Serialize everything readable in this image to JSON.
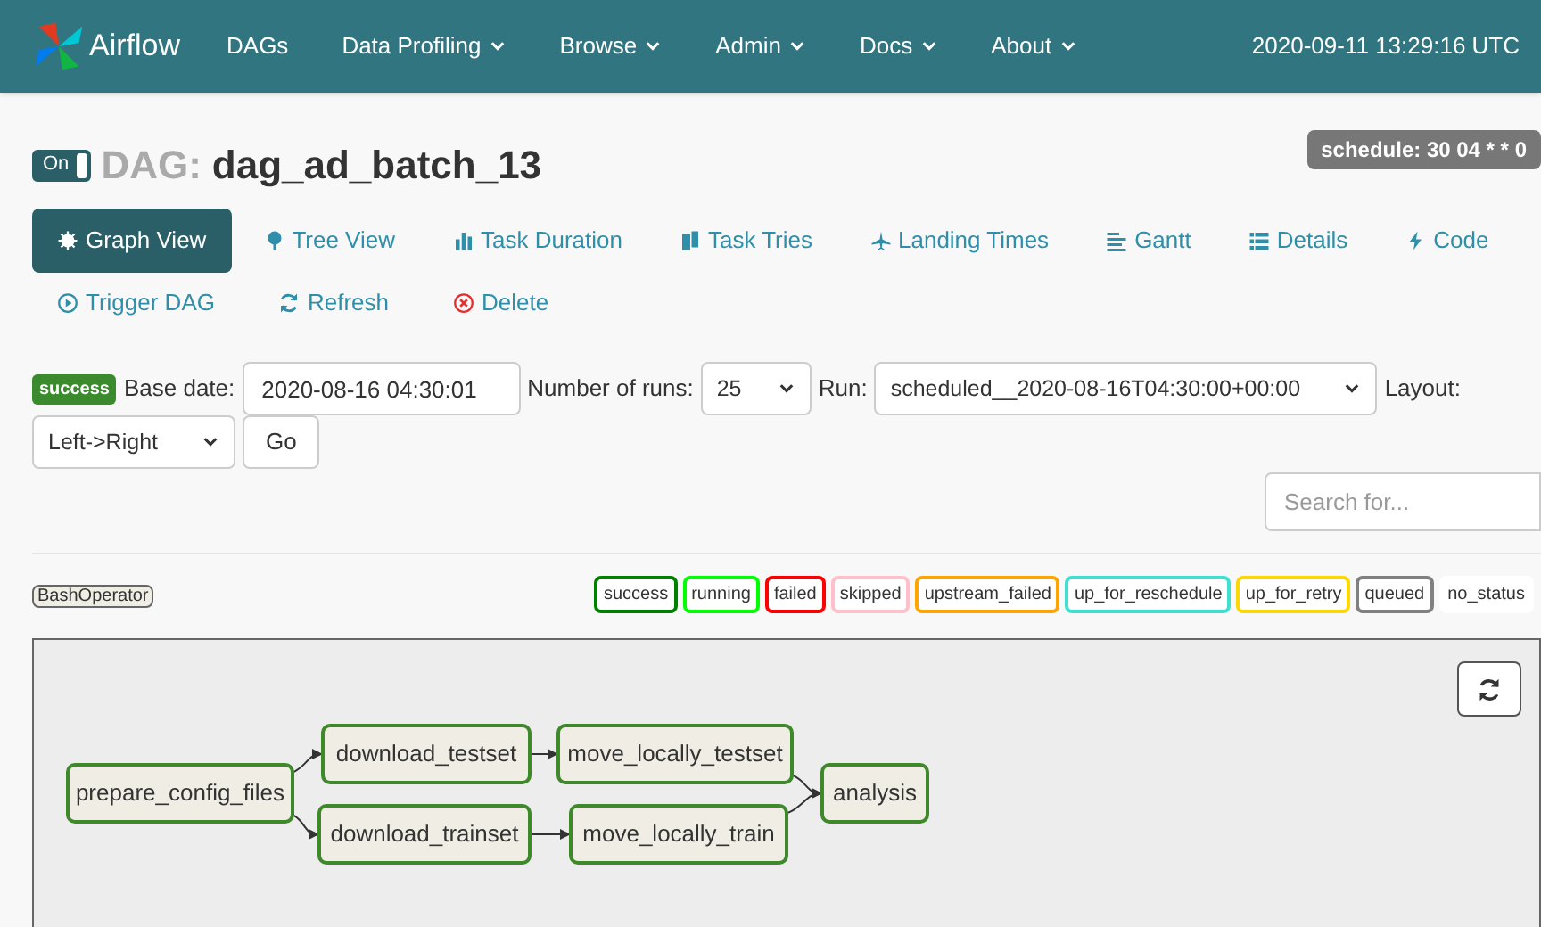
{
  "navbar": {
    "brand": "Airflow",
    "items": [
      {
        "label": "DAGs",
        "dropdown": false
      },
      {
        "label": "Data Profiling",
        "dropdown": true
      },
      {
        "label": "Browse",
        "dropdown": true
      },
      {
        "label": "Admin",
        "dropdown": true
      },
      {
        "label": "Docs",
        "dropdown": true
      },
      {
        "label": "About",
        "dropdown": true
      }
    ],
    "clock": "2020-09-11 13:29:16 UTC"
  },
  "dag": {
    "toggle": "On",
    "on": true,
    "prefix": "DAG:",
    "name": "dag_ad_batch_13",
    "schedule": "schedule: 30 04 * * 0"
  },
  "tabs": [
    {
      "label": "Graph View",
      "selected": true
    },
    {
      "label": "Tree View",
      "selected": false
    },
    {
      "label": "Task Duration",
      "selected": false
    },
    {
      "label": "Task Tries",
      "selected": false
    },
    {
      "label": "Landing Times",
      "selected": false
    },
    {
      "label": "Gantt",
      "selected": false
    },
    {
      "label": "Details",
      "selected": false
    },
    {
      "label": "Code",
      "selected": false
    }
  ],
  "actions": [
    {
      "label": "Trigger DAG"
    },
    {
      "label": "Refresh"
    },
    {
      "label": "Delete"
    }
  ],
  "form": {
    "status": "success",
    "base_date_label": "Base date:",
    "base_date": "2020-08-16 04:30:01",
    "runs_label": "Number of runs:",
    "runs": "25",
    "run_label": "Run:",
    "run": "scheduled__2020-08-16T04:30:00+00:00",
    "layout_label": "Layout:",
    "layout": "Left->Right",
    "go": "Go",
    "search_placeholder": "Search for..."
  },
  "operators": [
    {
      "label": "BashOperator"
    }
  ],
  "legend": [
    {
      "label": "success",
      "color": "#008000"
    },
    {
      "label": "running",
      "color": "#00ff00"
    },
    {
      "label": "failed",
      "color": "#ff0000"
    },
    {
      "label": "skipped",
      "color": "#ffc0cb"
    },
    {
      "label": "upstream_failed",
      "color": "#ffa500"
    },
    {
      "label": "up_for_reschedule",
      "color": "#40e0d0"
    },
    {
      "label": "up_for_retry",
      "color": "#ffd700"
    },
    {
      "label": "queued",
      "color": "#808080"
    },
    {
      "label": "no_status",
      "color": "#ffffff"
    }
  ],
  "graph": {
    "nodes": [
      {
        "label": "prepare_config_files"
      },
      {
        "label": "download_testset"
      },
      {
        "label": "download_trainset"
      },
      {
        "label": "move_locally_testset"
      },
      {
        "label": "move_locally_train"
      },
      {
        "label": "analysis"
      }
    ]
  }
}
